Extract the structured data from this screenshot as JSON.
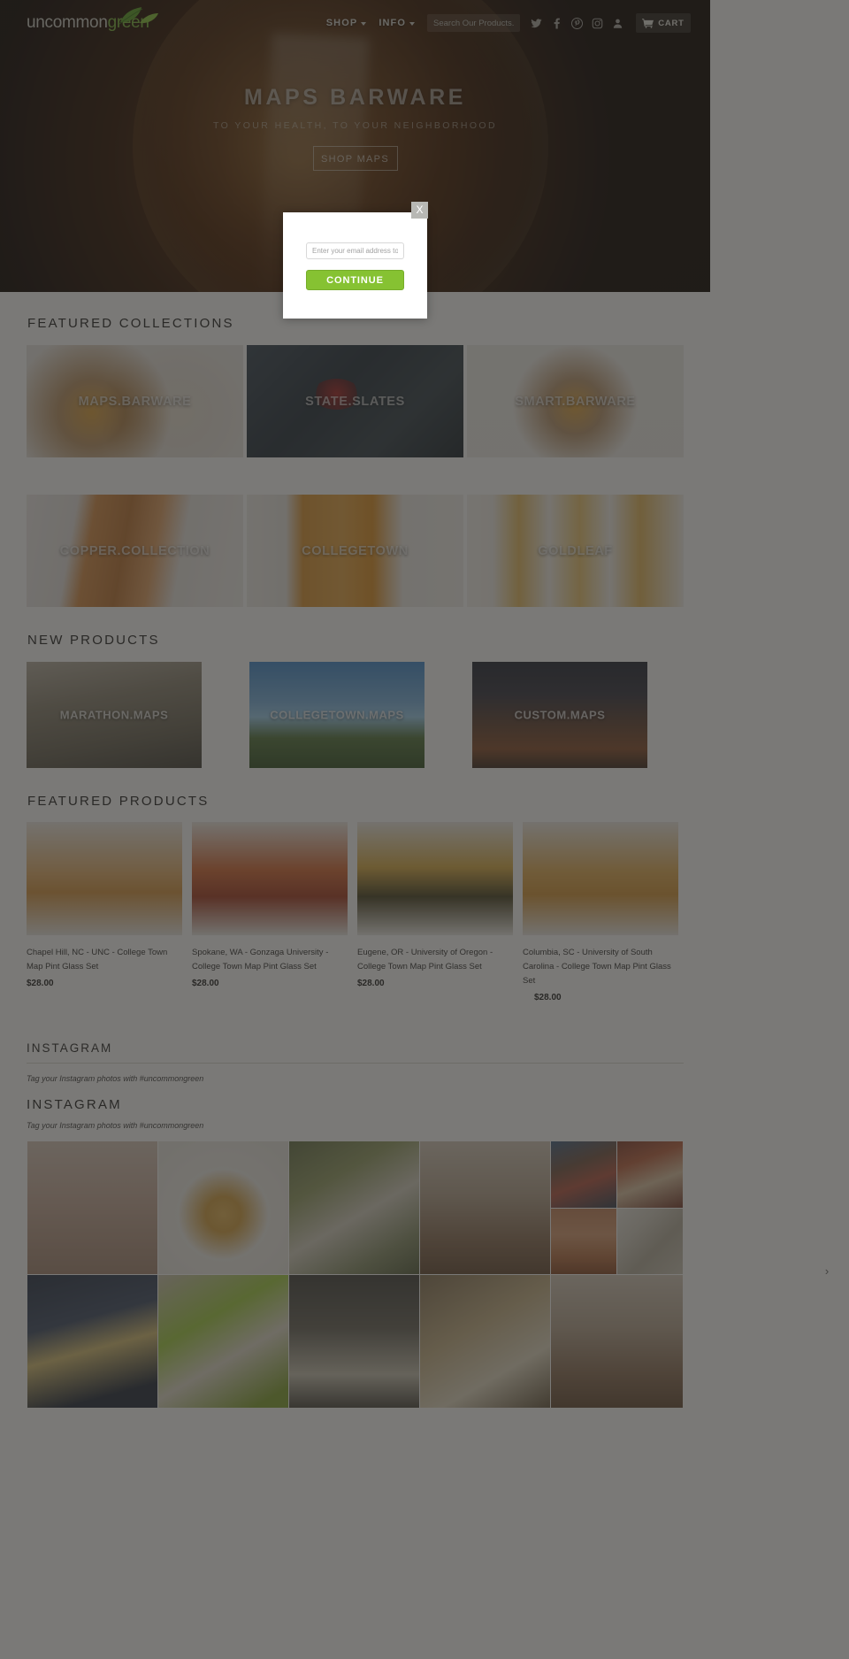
{
  "header": {
    "logo_text_1": "uncommon",
    "logo_text_2": "green",
    "nav": [
      {
        "label": "SHOP",
        "has_caret": true
      },
      {
        "label": "INFO",
        "has_caret": true
      }
    ],
    "search_placeholder": "Search Our Products...",
    "social": [
      {
        "name": "twitter-icon",
        "glyph": "𝕏"
      },
      {
        "name": "facebook-icon",
        "glyph": "f"
      },
      {
        "name": "pinterest-icon",
        "glyph": "P"
      },
      {
        "name": "instagram-icon",
        "glyph": "▣"
      },
      {
        "name": "account-icon",
        "glyph": "♟"
      }
    ],
    "cart_label": "CART",
    "cart_icon": "shopping-cart-icon"
  },
  "hero": {
    "title": "MAPS BARWARE",
    "subtitle": "TO YOUR HEALTH, TO YOUR NEIGHBORHOOD",
    "button_label": "SHOP MAPS"
  },
  "modal": {
    "close_label": "X",
    "email_placeholder": "Enter your email address to receive",
    "continue_label": "CONTINUE"
  },
  "featured_collections": {
    "title": "FEATURED COLLECTIONS",
    "tiles": [
      {
        "label": "MAPS.BARWARE",
        "art": "img-maps-barware"
      },
      {
        "label": "STATE.SLATES",
        "art": "img-state-slates"
      },
      {
        "label": "SMART.BARWARE",
        "art": "img-smart-barware"
      },
      {
        "label": "COPPER.COLLECTION",
        "art": "img-copper"
      },
      {
        "label": "COLLEGETOWN",
        "art": "img-collegetown"
      },
      {
        "label": "GOLDLEAF",
        "art": "img-goldleaf"
      }
    ]
  },
  "new_products": {
    "title": "NEW PRODUCTS",
    "tiles": [
      {
        "label": "MARATHON.MAPS",
        "art": "img-marathon"
      },
      {
        "label": "COLLEGETOWN.MAPS",
        "art": "img-ctmaps"
      },
      {
        "label": "CUSTOM.MAPS",
        "art": "img-custom"
      }
    ]
  },
  "featured_products": {
    "title": "FEATURED PRODUCTS",
    "items": [
      {
        "name": "Chapel Hill, NC - UNC - College Town Map Pint Glass Set",
        "price": "$28.00",
        "art": "a"
      },
      {
        "name": "Spokane, WA - Gonzaga University - College Town Map Pint Glass Set",
        "price": "$28.00",
        "art": "b"
      },
      {
        "name": "Eugene, OR - University of Oregon - College Town Map Pint Glass Set",
        "price": "$28.00",
        "art": "c"
      },
      {
        "name": "Columbia, SC - University of South Carolina - College Town Map Pint Glass Set",
        "price": "$28.00",
        "art": "d"
      }
    ]
  },
  "instagram": {
    "heading_1": "INSTAGRAM",
    "tagline_1": "Tag your Instagram photos with #uncommongreen",
    "heading_2": "INSTAGRAM",
    "tagline_2": "Tag your Instagram photos with #uncommongreen",
    "next_arrow": "›"
  },
  "colors": {
    "accent_green": "#86c232",
    "logo_green": "#7fb843",
    "overlay_dim": "rgba(40,38,35,0.62)",
    "modal_close_bg": "#b8b8b4"
  }
}
